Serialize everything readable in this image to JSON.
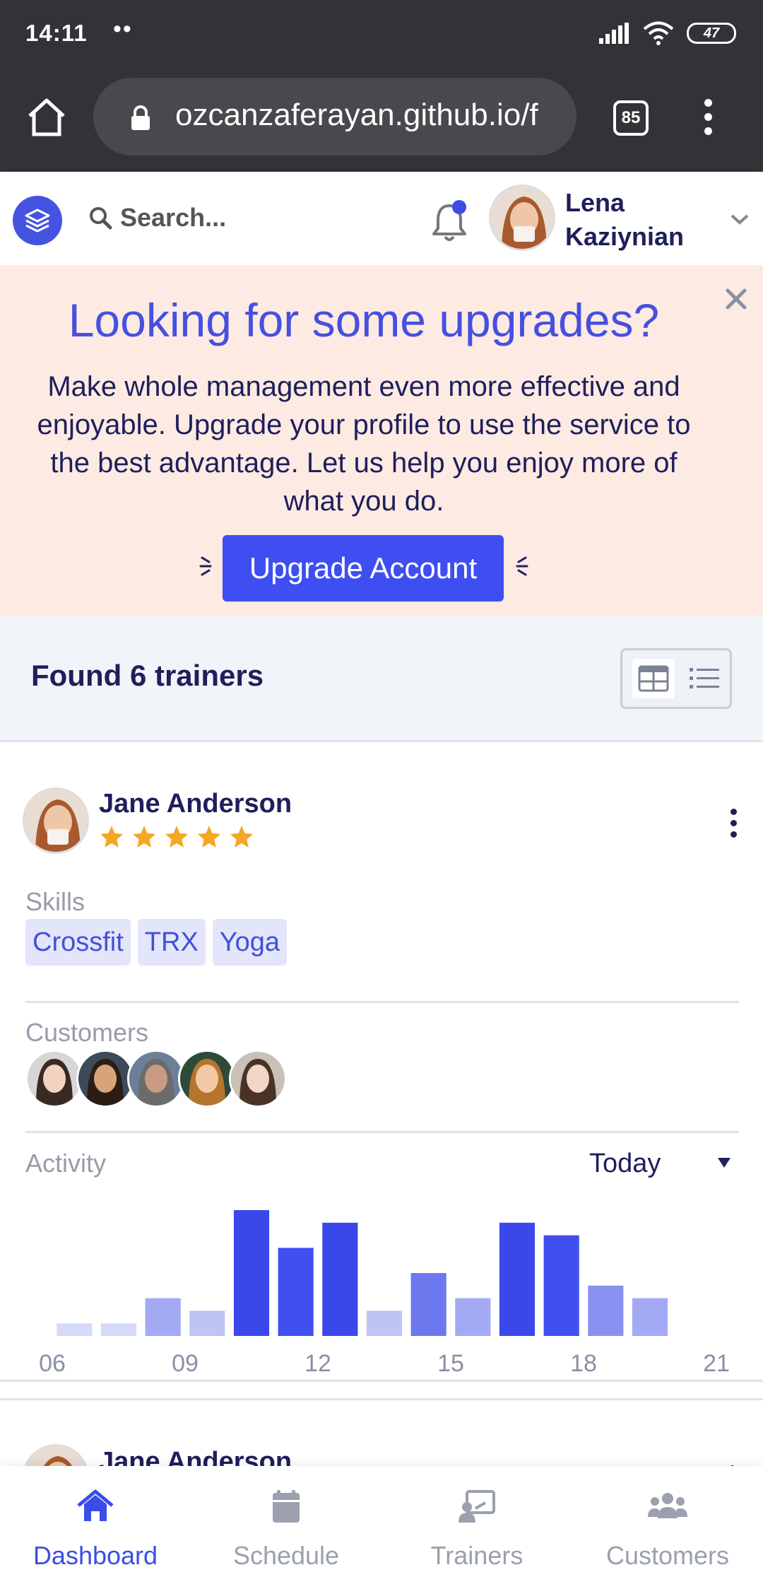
{
  "status_bar": {
    "time": "14:11",
    "dots": "••",
    "battery": "47"
  },
  "browser": {
    "url": "ozcanzaferayan.github.io/f",
    "tab_count": "85"
  },
  "header": {
    "search_placeholder": "Search...",
    "user_first": "Lena",
    "user_last": "Kaziynian",
    "accent_color": "#3b4de8"
  },
  "banner": {
    "title": "Looking for some upgrades?",
    "text": "Make whole management even more effective and enjoyable. Upgrade your profile to use the service to the best advantage. Let us help you enjoy more of what you do.",
    "button": "Upgrade Account",
    "background": "#fdeae3"
  },
  "results": {
    "found_text": "Found 6 trainers",
    "view_mode": "grid"
  },
  "trainer": {
    "name": "Jane Anderson",
    "rating": 5,
    "skills_label": "Skills",
    "skills": [
      "Crossfit",
      "TRX",
      "Yoga"
    ],
    "customers_label": "Customers",
    "customers": [
      "customer-1",
      "customer-2",
      "customer-3",
      "customer-4",
      "customer-5"
    ],
    "activity_label": "Activity",
    "activity_period": "Today"
  },
  "trainer_next": {
    "name": "Jane Anderson"
  },
  "chart_data": {
    "type": "bar",
    "x": [
      6.5,
      7.5,
      8.5,
      9.5,
      10.5,
      11.5,
      12.5,
      13.5,
      14.5,
      15.5,
      16.5,
      17.5,
      18.5,
      19.5
    ],
    "values": [
      1,
      1,
      3,
      2,
      10,
      7,
      9,
      2,
      5,
      3,
      9,
      8,
      4,
      3
    ],
    "xticks": [
      "06",
      "09",
      "12",
      "15",
      "18",
      "21"
    ],
    "xlim": [
      6,
      21
    ],
    "ylim": [
      0,
      10
    ],
    "grid": false,
    "title": "",
    "xlabel": "",
    "ylabel": ""
  },
  "bottom_nav": [
    {
      "label": "Dashboard",
      "active": true
    },
    {
      "label": "Schedule",
      "active": false
    },
    {
      "label": "Trainers",
      "active": false
    },
    {
      "label": "Customers",
      "active": false
    }
  ]
}
